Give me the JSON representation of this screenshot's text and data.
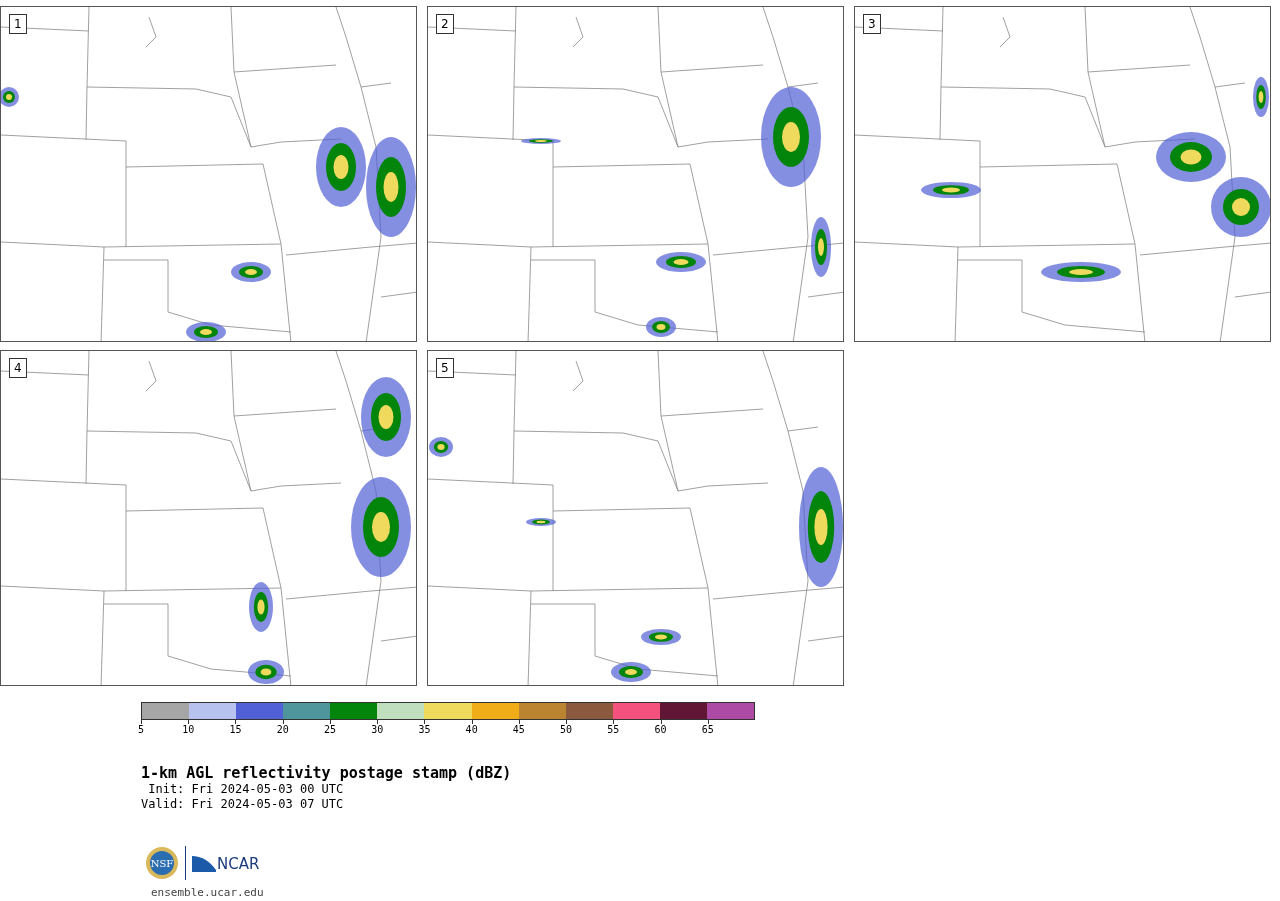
{
  "panels": [
    {
      "number": "1"
    },
    {
      "number": "2"
    },
    {
      "number": "3"
    },
    {
      "number": "4"
    },
    {
      "number": "5"
    }
  ],
  "colorbar": {
    "segments": [
      {
        "color": "#a6a6a6"
      },
      {
        "color": "#b7c3ee"
      },
      {
        "color": "#5160d6"
      },
      {
        "color": "#4f969c"
      },
      {
        "color": "#03840a"
      },
      {
        "color": "#c0dfbf"
      },
      {
        "color": "#f0da5d"
      },
      {
        "color": "#f0ad18"
      },
      {
        "color": "#bb8431"
      },
      {
        "color": "#8b5a3e"
      },
      {
        "color": "#f5517e"
      },
      {
        "color": "#621635"
      },
      {
        "color": "#ac4aa6"
      }
    ],
    "ticks": [
      "5",
      "10",
      "15",
      "20",
      "25",
      "30",
      "35",
      "40",
      "45",
      "50",
      "55",
      "60",
      "65"
    ]
  },
  "title": "1-km AGL reflectivity postage stamp (dBZ)",
  "init": " Init: Fri 2024-05-03 00 UTC",
  "valid": "Valid: Fri 2024-05-03 07 UTC",
  "logo": {
    "left": "NSF",
    "right": "NCAR"
  },
  "url": "ensemble.ucar.edu"
}
